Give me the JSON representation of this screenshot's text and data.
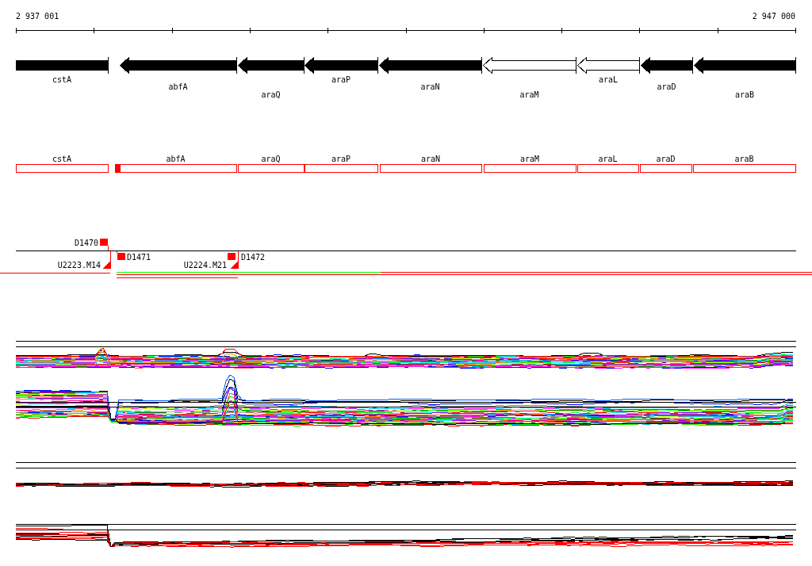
{
  "ruler": {
    "start_label": "2 937 001",
    "end_label": "2 947 000"
  },
  "genes": [
    {
      "name": "cstA",
      "filled": true,
      "arrow": false
    },
    {
      "name": "abfA",
      "filled": true,
      "arrow": true
    },
    {
      "name": "araQ",
      "filled": true,
      "arrow": true
    },
    {
      "name": "araP",
      "filled": true,
      "arrow": true
    },
    {
      "name": "araN",
      "filled": true,
      "arrow": true
    },
    {
      "name": "araM",
      "filled": false,
      "arrow": true
    },
    {
      "name": "araL",
      "filled": false,
      "arrow": true
    },
    {
      "name": "araD",
      "filled": true,
      "arrow": true
    },
    {
      "name": "araB",
      "filled": true,
      "arrow": true
    }
  ],
  "gene_spans": [
    {
      "name": "cstA",
      "marked": false
    },
    {
      "name": "abfA",
      "marked": true
    },
    {
      "name": "araQ",
      "marked": false
    },
    {
      "name": "araP",
      "marked": false
    },
    {
      "name": "araN",
      "marked": false
    },
    {
      "name": "araM",
      "marked": false
    },
    {
      "name": "araL",
      "marked": false
    },
    {
      "name": "araD",
      "marked": false
    },
    {
      "name": "araB",
      "marked": false
    }
  ],
  "features": [
    {
      "label": "D1470",
      "kind": "square"
    },
    {
      "label": "U2223.M14",
      "kind": "triangle"
    },
    {
      "label": "D1471",
      "kind": "square"
    },
    {
      "label": "U2224.M21",
      "kind": "triangle"
    },
    {
      "label": "D1472",
      "kind": "square"
    }
  ]
}
